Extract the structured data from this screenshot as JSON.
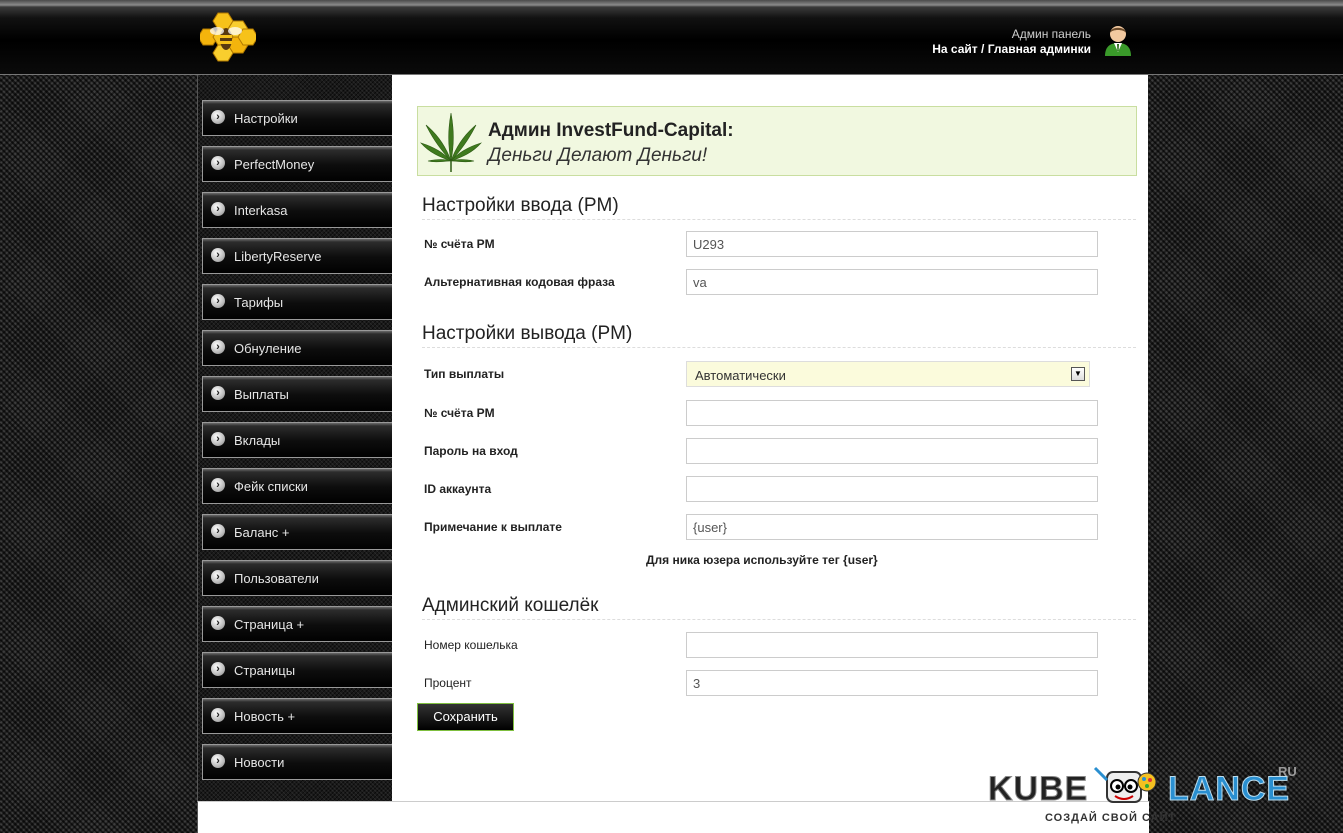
{
  "header": {
    "admin_panel": "Админ панель",
    "link_site": "На сайт",
    "separator": " / ",
    "link_admin_home": "Главная админки"
  },
  "sidebar": {
    "items": [
      {
        "label": "Настройки"
      },
      {
        "label": "PerfectMoney"
      },
      {
        "label": "Interkasa"
      },
      {
        "label": "LibertyReserve"
      },
      {
        "label": "Тарифы"
      },
      {
        "label": "Обнуление"
      },
      {
        "label": "Выплаты"
      },
      {
        "label": "Вклады"
      },
      {
        "label": "Фейк списки"
      },
      {
        "label": "Баланс +"
      },
      {
        "label": "Пользователи"
      },
      {
        "label": "Страница +"
      },
      {
        "label": "Страницы"
      },
      {
        "label": "Новость +"
      },
      {
        "label": "Новости"
      }
    ]
  },
  "banner": {
    "title": "Админ InvestFund-Capital:",
    "subtitle": "Деньги Делают Деньги!"
  },
  "input_settings": {
    "title": "Настройки ввода (PM)",
    "account_label": "№ счёта PM",
    "account_value": "U293",
    "alt_phrase_label": "Альтернативная кодовая фраза",
    "alt_phrase_value": "va"
  },
  "output_settings": {
    "title": "Настройки вывода (PM)",
    "payout_type_label": "Тип выплаты",
    "payout_type_value": "Автоматически",
    "account_label": "№ счёта PM",
    "account_value": "",
    "password_label": "Пароль на вход",
    "password_value": "",
    "account_id_label": "ID аккаунта",
    "account_id_value": "",
    "note_label": "Примечание к выплате",
    "note_value": "{user}",
    "hint": "Для ника юзера используйте тег {user}"
  },
  "admin_wallet": {
    "title": "Админский кошелёк",
    "wallet_label": "Номер кошелька",
    "wallet_value": "",
    "percent_label": "Процент",
    "percent_value": "3"
  },
  "save_label": "Сохранить",
  "watermark": {
    "kube": "KUBE",
    "lance": "LANCE",
    "ru": "RU",
    "tagline": "СОЗДАЙ СВОЙ САЙТ"
  },
  "icons": {
    "logo": "bee-honeycomb-logo-icon",
    "avatar": "admin-user-icon",
    "bullet": "chevron-right-circle-icon",
    "banner": "leaf-icon",
    "select_arrow": "chevron-down-icon"
  }
}
